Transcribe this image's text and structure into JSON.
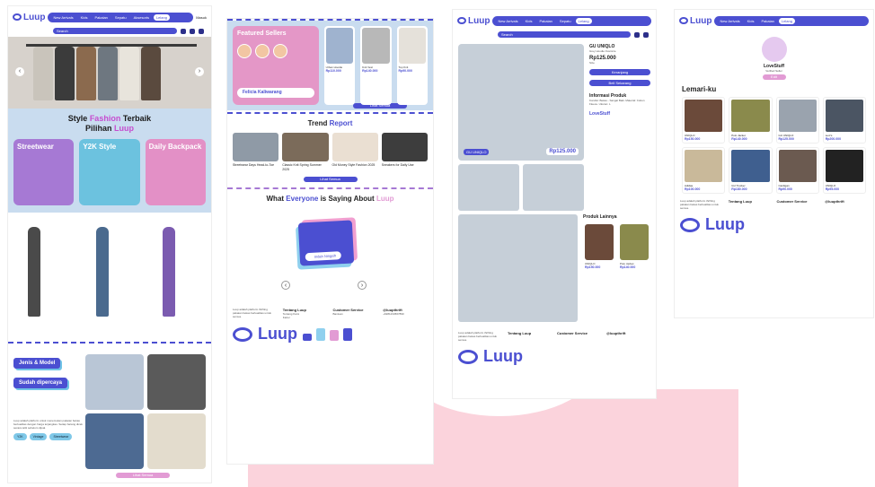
{
  "brand": {
    "name": "Luup",
    "accent": "#4b4fd1",
    "pink": "#e29bd4",
    "lightblue": "#c9dcef"
  },
  "nav": {
    "items": [
      "New Arrivals",
      "Kids",
      "Pakaian",
      "Sepatu",
      "Aksesoris"
    ],
    "active": "Lelang",
    "profile": "Masuk",
    "search_placeholder": "Search"
  },
  "home": {
    "hero_title_1": "Style",
    "hero_title_accent": "Fashion",
    "hero_title_2": "Terbaik",
    "hero_title_3": "Pilihan",
    "hero_title_brand": "Luup",
    "categories": [
      "Streetwear",
      "Y2K Style",
      "Daily Backpack"
    ],
    "section_jenis": "Jenis & Model",
    "section_trust": "Sudah dipercaya",
    "body_text": "Luup adalah platform untuk menemukan pakaian bekas berkualitas dengan harga terjangkau. Setiap barang dicek secara teliti sebelum dijual.",
    "tags": [
      "Y2K",
      "Vintage",
      "Streetwear"
    ],
    "more_button": "Lihat Semua"
  },
  "landing2": {
    "featured_title": "Featured Sellers",
    "featured_name": "Felicia Kaliwarang",
    "products": [
      {
        "name": "Urban Hoodie",
        "price": "Rp110.000"
      },
      {
        "name": "Knit Vest",
        "price": "Rp140.000"
      },
      {
        "name": "Top Knit",
        "price": "Rp90.000"
      }
    ],
    "see_all": "Lihat Semua",
    "trend_title": "Trend",
    "trend_accent": "Report",
    "trends": [
      "Streetwear Days Head-to-Toe",
      "Classic Knit Spring Summer 2025",
      "Old Money Style Fashion 2025",
      "Sneakers for Daily Use"
    ],
    "trend_button": "Lihat Semua",
    "testi_title_1": "What",
    "testi_title_accent": "Everyone",
    "testi_title_2": "is Saying About",
    "testi_title_brand": "Luup",
    "testi_name": "Indah Ningsih"
  },
  "product": {
    "shop_label": "GU UNIQLO",
    "title": "GU UNIQLO",
    "subtitle": "Grey Hoodie Oversize",
    "price": "Rp125.000",
    "size": "Size",
    "buy": "Keranjang",
    "buy_now": "Beli Sekarang",
    "info_title": "Informasi Produk",
    "info_text": "Kondisi: Bekas - Sangat Baik. Material: Cotton Fleece. Ukuran: L",
    "seller_name": "LoveStuff",
    "related_title": "Produk Lainnya",
    "related": [
      {
        "name": "UNIQLO",
        "price": "Rp150.000"
      },
      {
        "name": "Polo Jacket",
        "price": "Rp140.000"
      }
    ]
  },
  "closet": {
    "seller_name": "LoveStuff",
    "seller_sub": "Verified Seller",
    "follow": "Edit",
    "title": "Lemari-ku",
    "items": [
      {
        "name": "UNIQLO",
        "price": "Rp150.000",
        "color": "#6b4a3a"
      },
      {
        "name": "Polo Jacket",
        "price": "Rp140.000",
        "color": "#8a8a4c"
      },
      {
        "name": "GU UNIQLO",
        "price": "Rp125.000",
        "color": "#9aa3ae"
      },
      {
        "name": "Levi's",
        "price": "Rp200.000",
        "color": "#4b5563"
      },
      {
        "name": "Adidas",
        "price": "Rp100.000",
        "color": "#c9b99a"
      },
      {
        "name": "GU Trucker",
        "price": "Rp180.000",
        "color": "#3f5f8f"
      },
      {
        "name": "Cardigan",
        "price": "Rp90.000",
        "color": "#6b5a50"
      },
      {
        "name": "UNIQLO",
        "price": "Rp95.000",
        "color": "#222"
      }
    ]
  },
  "footer": {
    "about": "Luup adalah platform thrifting pakaian bekas berkualitas untuk semua.",
    "col1_title": "Tentang Luup",
    "col1_items": [
      "Tentang Kami",
      "Karier",
      "Blog"
    ],
    "col2_title": "Customer Service",
    "col2_items": [
      "Bantuan",
      "Kebijakan"
    ],
    "col3_title": "@luupthrift",
    "col3_sub": "+6281234567890",
    "big_brand": "Luup"
  }
}
